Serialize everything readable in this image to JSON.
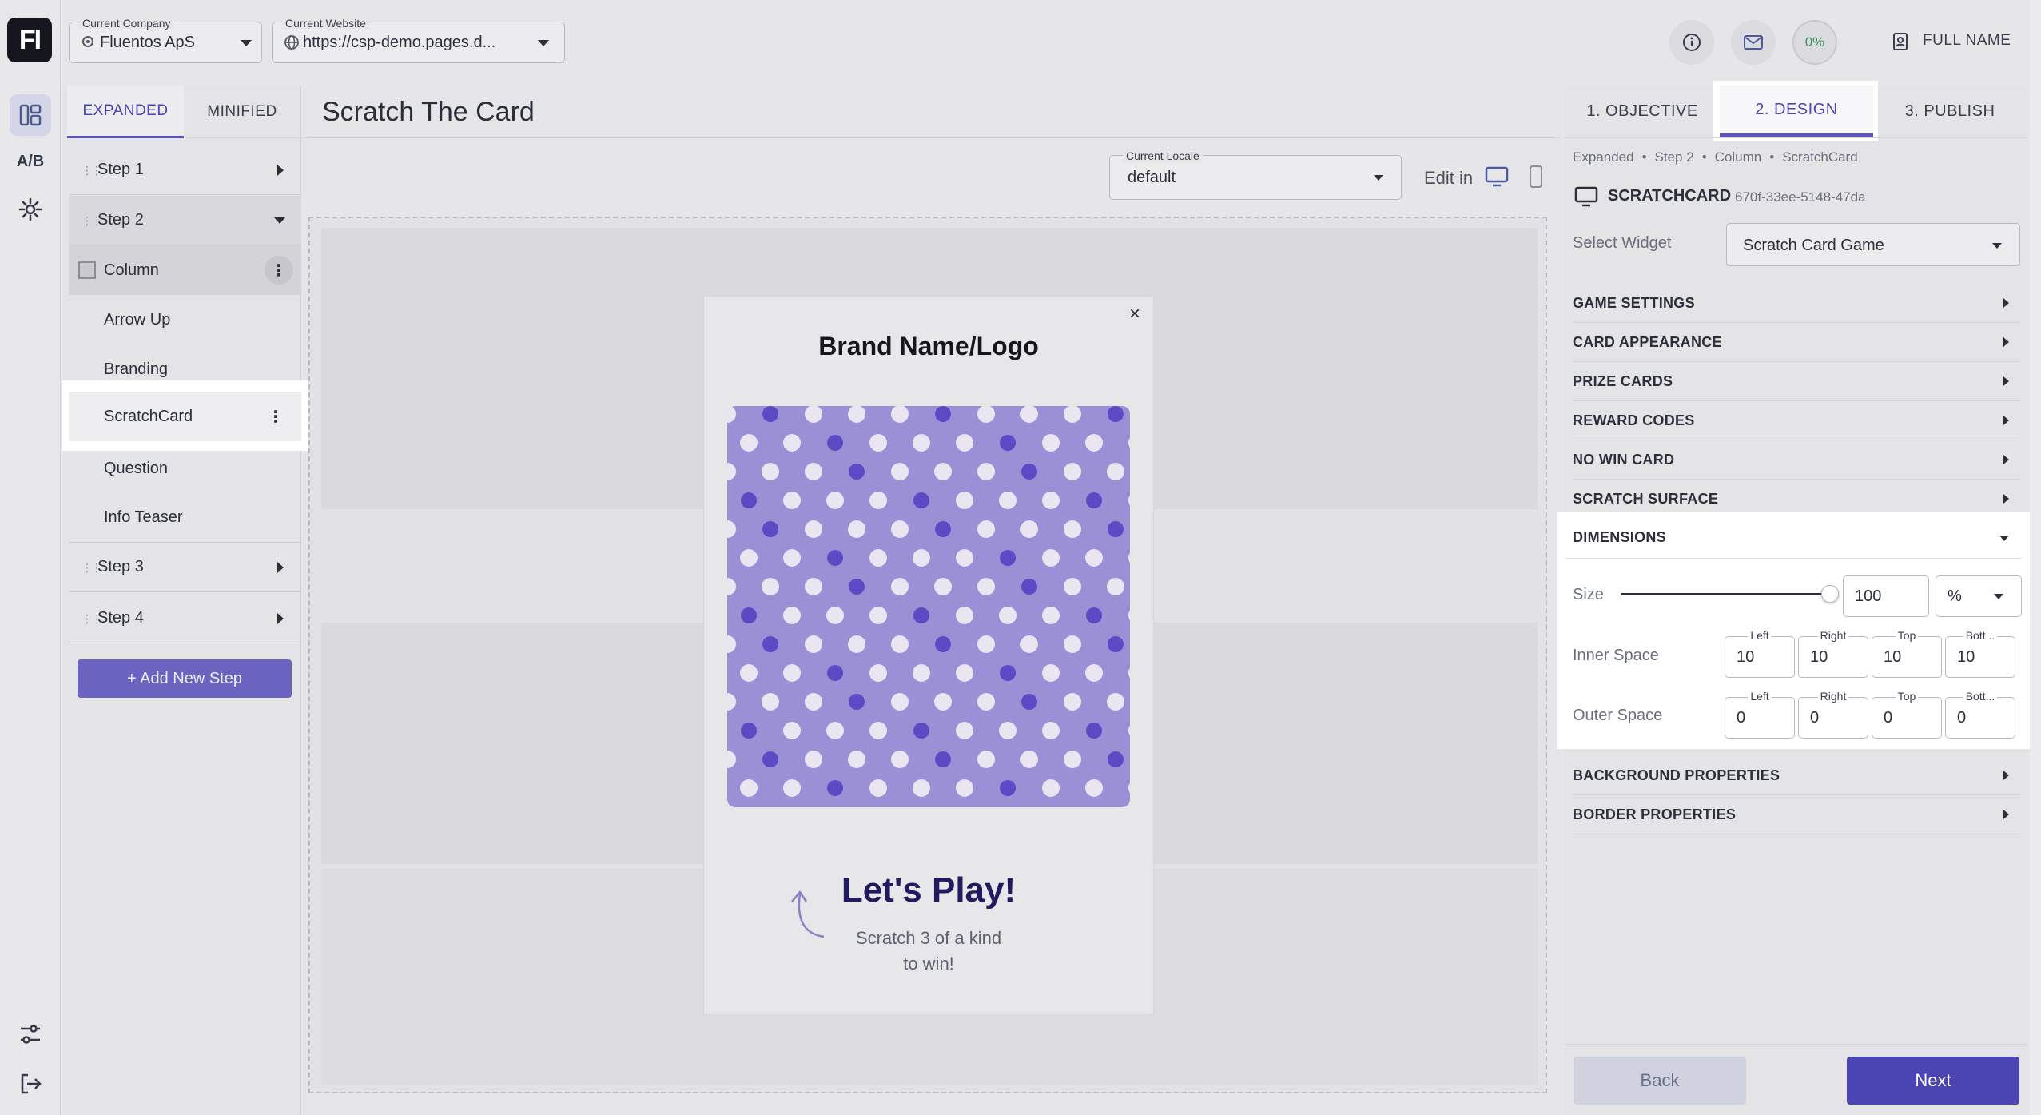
{
  "app": {
    "logo_text": "FI"
  },
  "rail": {
    "ab_label": "A/B"
  },
  "header": {
    "company": {
      "label": "Current Company",
      "value": "Fluentos ApS"
    },
    "website": {
      "label": "Current Website",
      "value": "https://csp-demo.pages.d..."
    },
    "progress": "0%",
    "user_name": "FULL NAME"
  },
  "tree": {
    "tabs": [
      "EXPANDED",
      "MINIFIED"
    ],
    "steps": [
      "Step 1",
      "Step 2",
      "Step 3",
      "Step 4"
    ],
    "column_label": "Column",
    "children": [
      "Arrow Up",
      "Branding",
      "ScratchCard",
      "Question",
      "Info Teaser"
    ],
    "add_step": "+ Add New Step"
  },
  "canvas": {
    "title": "Scratch The Card",
    "locale_label": "Current Locale",
    "locale_value": "default",
    "edit_in": "Edit in",
    "popup": {
      "close": "×",
      "brand": "Brand Name/Logo",
      "heading": "Let's Play!",
      "subtext_line1": "Scratch 3 of a kind",
      "subtext_line2": "to win!"
    },
    "colors": {
      "card_bg": "#9b8fd6",
      "dot_light": "#e9e6f1",
      "dot_dark": "#5c49c4",
      "heading": "#221a5e"
    }
  },
  "panel": {
    "tabs": [
      "1. OBJECTIVE",
      "2. DESIGN",
      "3. PUBLISH"
    ],
    "breadcrumb": [
      "Expanded",
      "Step 2",
      "Column",
      "ScratchCard"
    ],
    "widget_title": "SCRATCHCARD",
    "widget_id": "670f-33ee-5148-47da",
    "select_widget_label": "Select Widget",
    "select_widget_value": "Scratch Card Game",
    "sections": [
      "GAME SETTINGS",
      "CARD APPEARANCE",
      "PRIZE CARDS",
      "REWARD CODES",
      "NO WIN CARD",
      "SCRATCH SURFACE"
    ],
    "dimensions": {
      "title": "DIMENSIONS",
      "size_label": "Size",
      "size_value": "100",
      "size_unit": "%",
      "size_level": 1.0,
      "inner_label": "Inner Space",
      "outer_label": "Outer Space",
      "side_labels": [
        "Left",
        "Right",
        "Top",
        "Bott..."
      ],
      "inner_values": [
        "10",
        "10",
        "10",
        "10"
      ],
      "outer_values": [
        "0",
        "0",
        "0",
        "0"
      ]
    },
    "sections_after": [
      "BACKGROUND PROPERTIES",
      "BORDER PROPERTIES"
    ],
    "back": "Back",
    "next": "Next",
    "accent": "#4b44b3"
  }
}
